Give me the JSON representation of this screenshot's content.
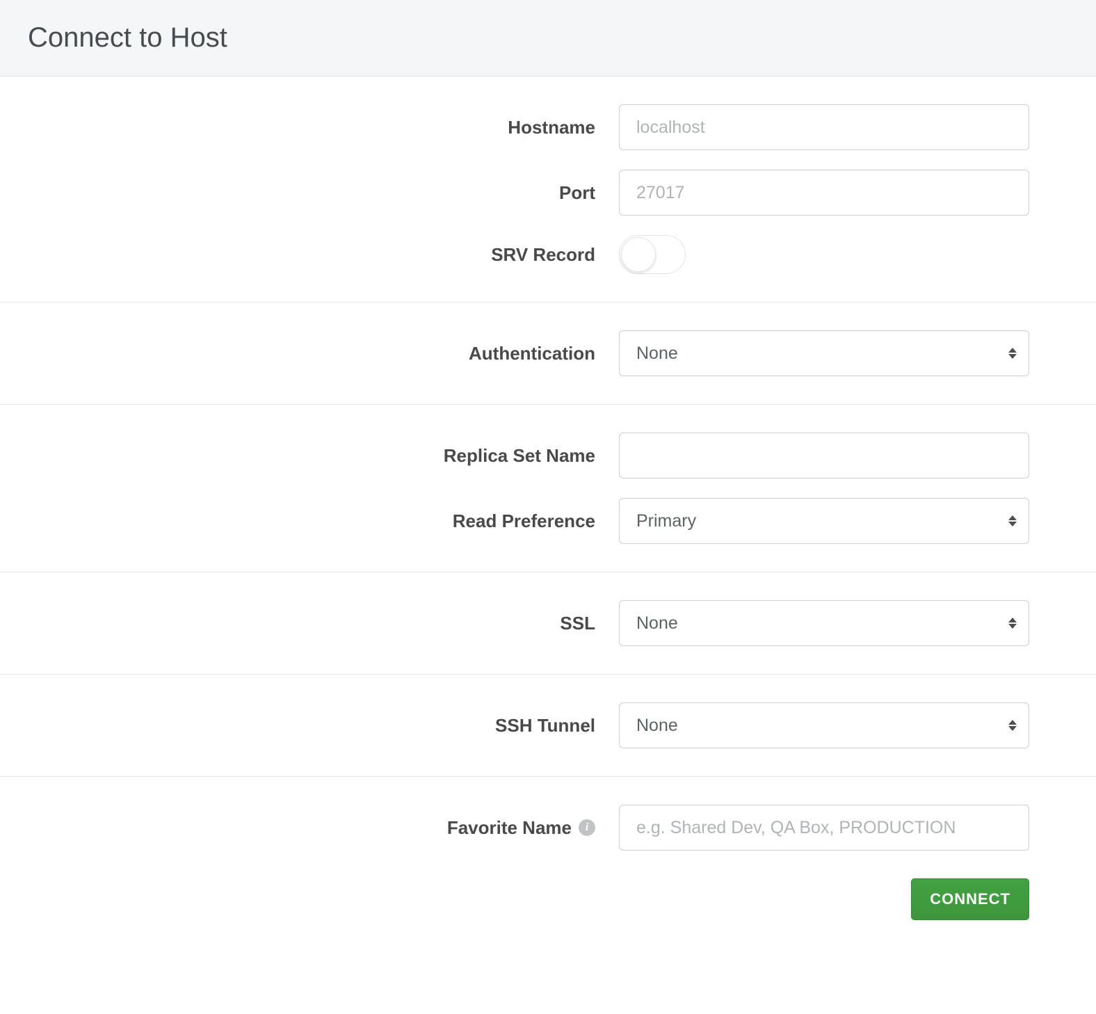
{
  "header": {
    "title": "Connect to Host"
  },
  "labels": {
    "hostname": "Hostname",
    "port": "Port",
    "srv_record": "SRV Record",
    "authentication": "Authentication",
    "replica_set_name": "Replica Set Name",
    "read_preference": "Read Preference",
    "ssl": "SSL",
    "ssh_tunnel": "SSH Tunnel",
    "favorite_name": "Favorite Name"
  },
  "fields": {
    "hostname_placeholder": "localhost",
    "hostname_value": "",
    "port_placeholder": "27017",
    "port_value": "",
    "srv_record_on": false,
    "authentication_value": "None",
    "replica_set_name_value": "",
    "read_preference_value": "Primary",
    "ssl_value": "None",
    "ssh_tunnel_value": "None",
    "favorite_name_placeholder": "e.g. Shared Dev, QA Box, PRODUCTION",
    "favorite_name_value": ""
  },
  "buttons": {
    "connect": "CONNECT"
  }
}
